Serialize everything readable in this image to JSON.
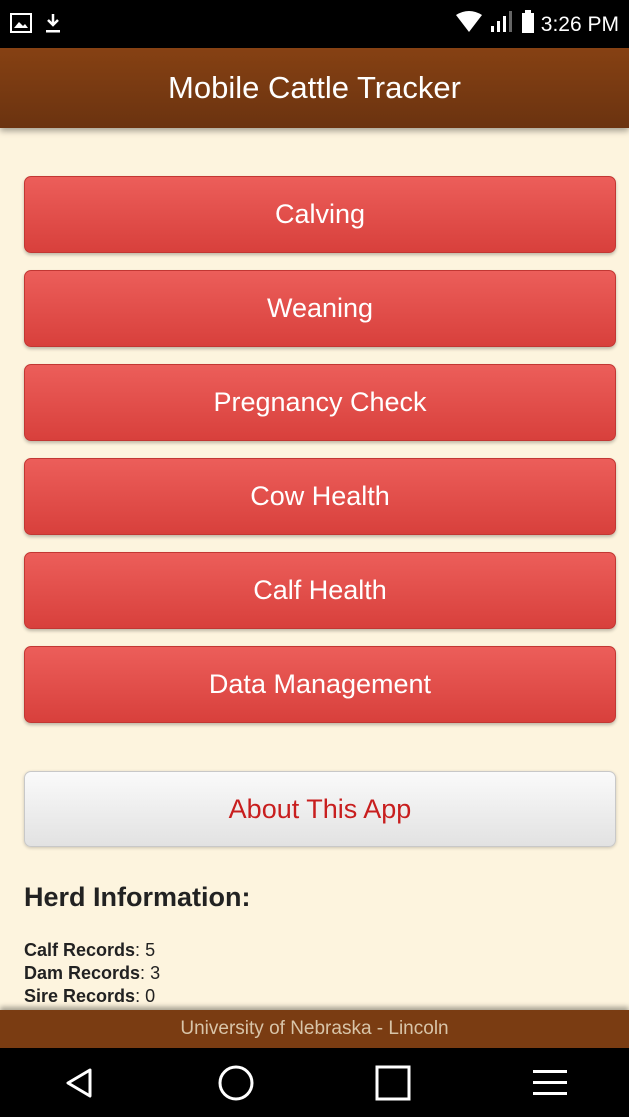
{
  "status_bar": {
    "time": "3:26 PM",
    "icons": [
      "image-icon",
      "download-icon",
      "wifi-icon",
      "signal-icon",
      "battery-icon"
    ]
  },
  "header": {
    "title": "Mobile Cattle Tracker"
  },
  "menu": {
    "items": [
      {
        "label": "Calving"
      },
      {
        "label": "Weaning"
      },
      {
        "label": "Pregnancy Check"
      },
      {
        "label": "Cow Health"
      },
      {
        "label": "Calf Health"
      },
      {
        "label": "Data Management"
      }
    ],
    "about_label": "About This App"
  },
  "herd": {
    "title": "Herd Information:",
    "records": [
      {
        "label": "Calf Records",
        "value": "5"
      },
      {
        "label": "Dam Records",
        "value": "3"
      },
      {
        "label": "Sire Records",
        "value": "0"
      }
    ],
    "separator": ": "
  },
  "footer": {
    "text": "University of Nebraska - Lincoln"
  },
  "nav_bar": {
    "icons": [
      "back-icon",
      "home-icon",
      "recents-icon",
      "menu-icon"
    ]
  },
  "colors": {
    "header": "#7a3c12",
    "background": "#fdf4de",
    "button_red": "#e24d49",
    "about_text": "#c81e1e"
  }
}
